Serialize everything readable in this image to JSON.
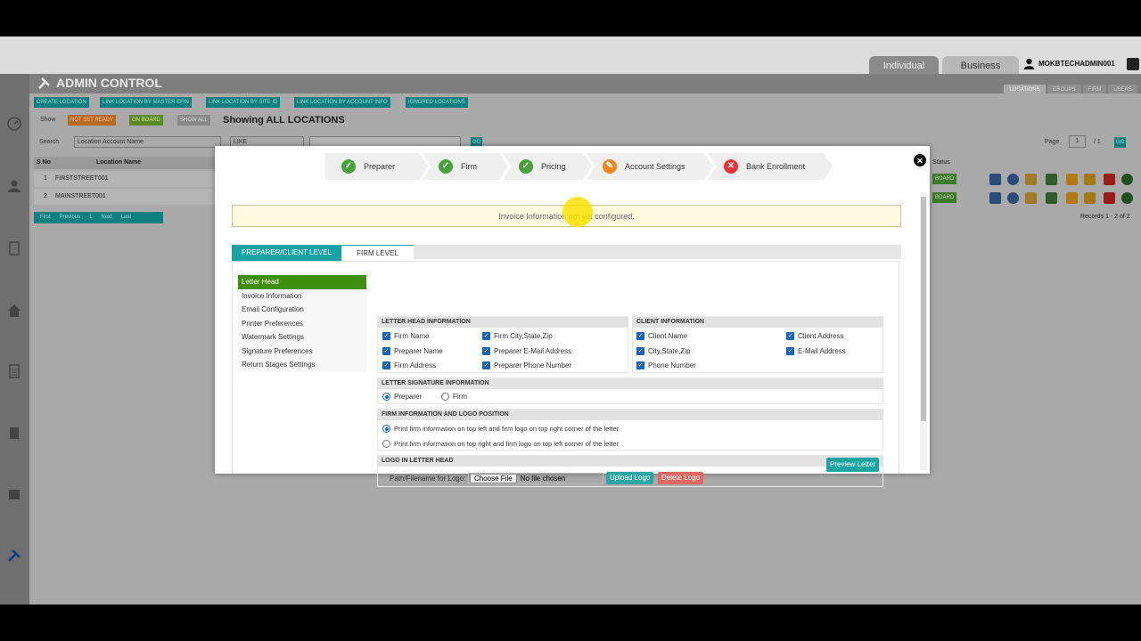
{
  "header": {
    "tabs": [
      "Individual",
      "Business"
    ],
    "user": "MOKBTECHADMIN001",
    "admin_title": "ADMIN CONTROL",
    "subtabs": [
      "LOCATIONS",
      "GROUPS",
      "FIRM",
      "USERS"
    ]
  },
  "toolbar": {
    "buttons": [
      "CREATE LOCATION",
      "LINK LOCATION BY MASTER EFIN",
      "LINK LOCATION BY SITE ID",
      "LINK LOCATION BY ACCOUNT INFO",
      "IGNORED LOCATIONS"
    ],
    "show_label": "Show",
    "filters": [
      "NOT SET READY",
      "ON BOARD",
      "SHOW ALL"
    ],
    "showing": "Showing ALL LOCATIONS",
    "search_label": "Search",
    "search_field": "Location Account Name",
    "search_op": "LIKE",
    "go": "GO",
    "page_label": "Page",
    "page_value": "1",
    "page_of": "/ 1",
    "records": "Records 1 - 2 of 2"
  },
  "table": {
    "headers": [
      "S.No",
      "Location Name"
    ],
    "status_header": "Status",
    "rows": [
      [
        "1",
        "FIRSTSTREET001"
      ],
      [
        "2",
        "MAINSTREET001"
      ]
    ],
    "status_badge": "BOARD",
    "pager": [
      "First",
      "Previous",
      "1",
      "Next",
      "Last"
    ]
  },
  "modal": {
    "steps": [
      {
        "label": "Preparer",
        "state": "done"
      },
      {
        "label": "Firm",
        "state": "done"
      },
      {
        "label": "Pricing",
        "state": "done"
      },
      {
        "label": "Account Settings",
        "state": "edit"
      },
      {
        "label": "Bank Enrollment",
        "state": "error"
      }
    ],
    "notice": "Invoice Information not yet configured.",
    "level_tabs": [
      "PREPARER/CLIENT LEVEL",
      "FIRM LEVEL"
    ],
    "menu": [
      "Letter Head",
      "Invoice Information",
      "Email Configuration",
      "Printer Preferences",
      "Watermark Settings",
      "Signature Preferences",
      "Return Stages Settings"
    ],
    "letter_head_info": {
      "title": "LETTER HEAD INFORMATION",
      "items": [
        "Firm Name",
        "Firm City,State,Zip",
        "Preparer Name",
        "Preparer E-Mail Address",
        "Firm Address",
        "Preparer Phone Number"
      ]
    },
    "client_info": {
      "title": "CLIENT INFORMATION",
      "items": [
        "Client Name",
        "Client Address",
        "City,State,Zip",
        "E-Mail Address",
        "Phone Number"
      ]
    },
    "signature": {
      "title": "LETTER SIGNATURE INFORMATION",
      "options": [
        "Preparer",
        "Firm"
      ]
    },
    "position": {
      "title": "FIRM INFORMATION AND LOGO POSITION",
      "options": [
        "Print firm information on top left and firm logo on top right corner of the letter",
        "Print firm information on top right and firm logo on top left corner of the letter"
      ]
    },
    "logo": {
      "title": "LOGO IN LETTER HEAD",
      "path_label": "Path/Filename for Logo:",
      "choose": "Choose File",
      "no_file": "No file chosen",
      "upload": "Upload Logo",
      "delete": "Delete Logo"
    },
    "preview": "Preview Letter",
    "close": "×"
  },
  "colors": {
    "teal": "#17a2a4",
    "green_active": "#3f8f0f",
    "upload": "#2ba6a0",
    "delete": "#e06a63"
  }
}
